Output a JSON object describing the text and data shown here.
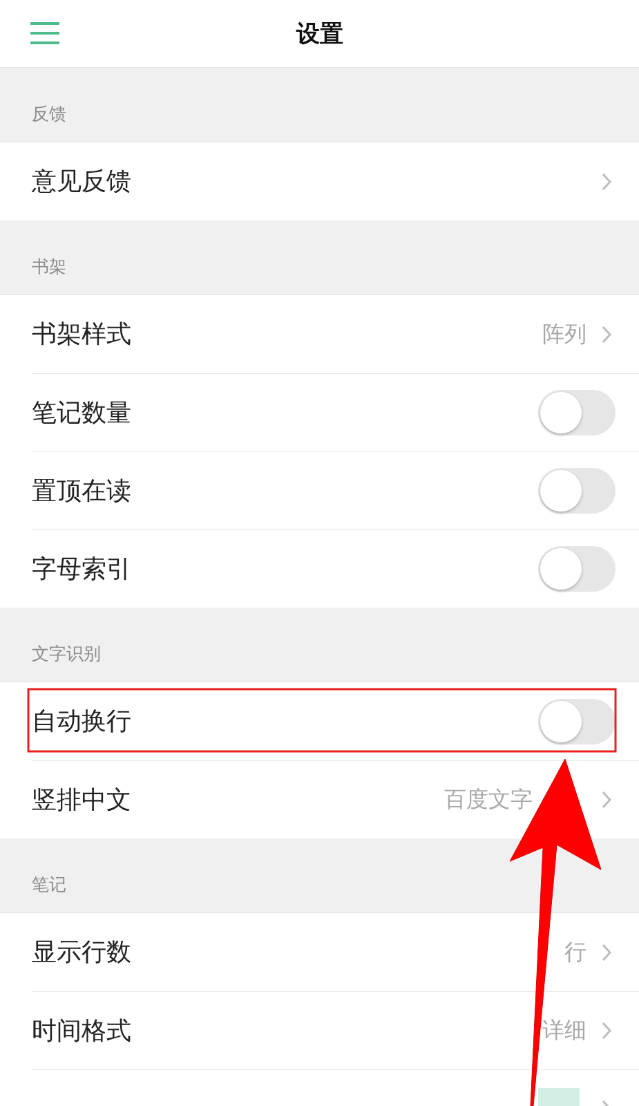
{
  "header": {
    "title": "设置"
  },
  "sections": [
    {
      "title": "反馈",
      "rows": [
        {
          "kind": "link",
          "label": "意见反馈"
        }
      ]
    },
    {
      "title": "书架",
      "rows": [
        {
          "kind": "link",
          "label": "书架样式",
          "value": "阵列"
        },
        {
          "kind": "toggle",
          "label": "笔记数量",
          "on": false
        },
        {
          "kind": "toggle",
          "label": "置顶在读",
          "on": false
        },
        {
          "kind": "toggle",
          "label": "字母索引",
          "on": false
        }
      ]
    },
    {
      "title": "文字识别",
      "rows": [
        {
          "kind": "toggle",
          "label": "自动换行",
          "on": false
        },
        {
          "kind": "link",
          "label": "竖排中文",
          "value": "百度文字"
        }
      ]
    },
    {
      "title": "笔记",
      "rows": [
        {
          "kind": "link",
          "label": "显示行数",
          "value": "行"
        },
        {
          "kind": "link",
          "label": "时间格式",
          "value": "详细"
        },
        {
          "kind": "color",
          "color": "#d2eee5"
        }
      ]
    }
  ]
}
